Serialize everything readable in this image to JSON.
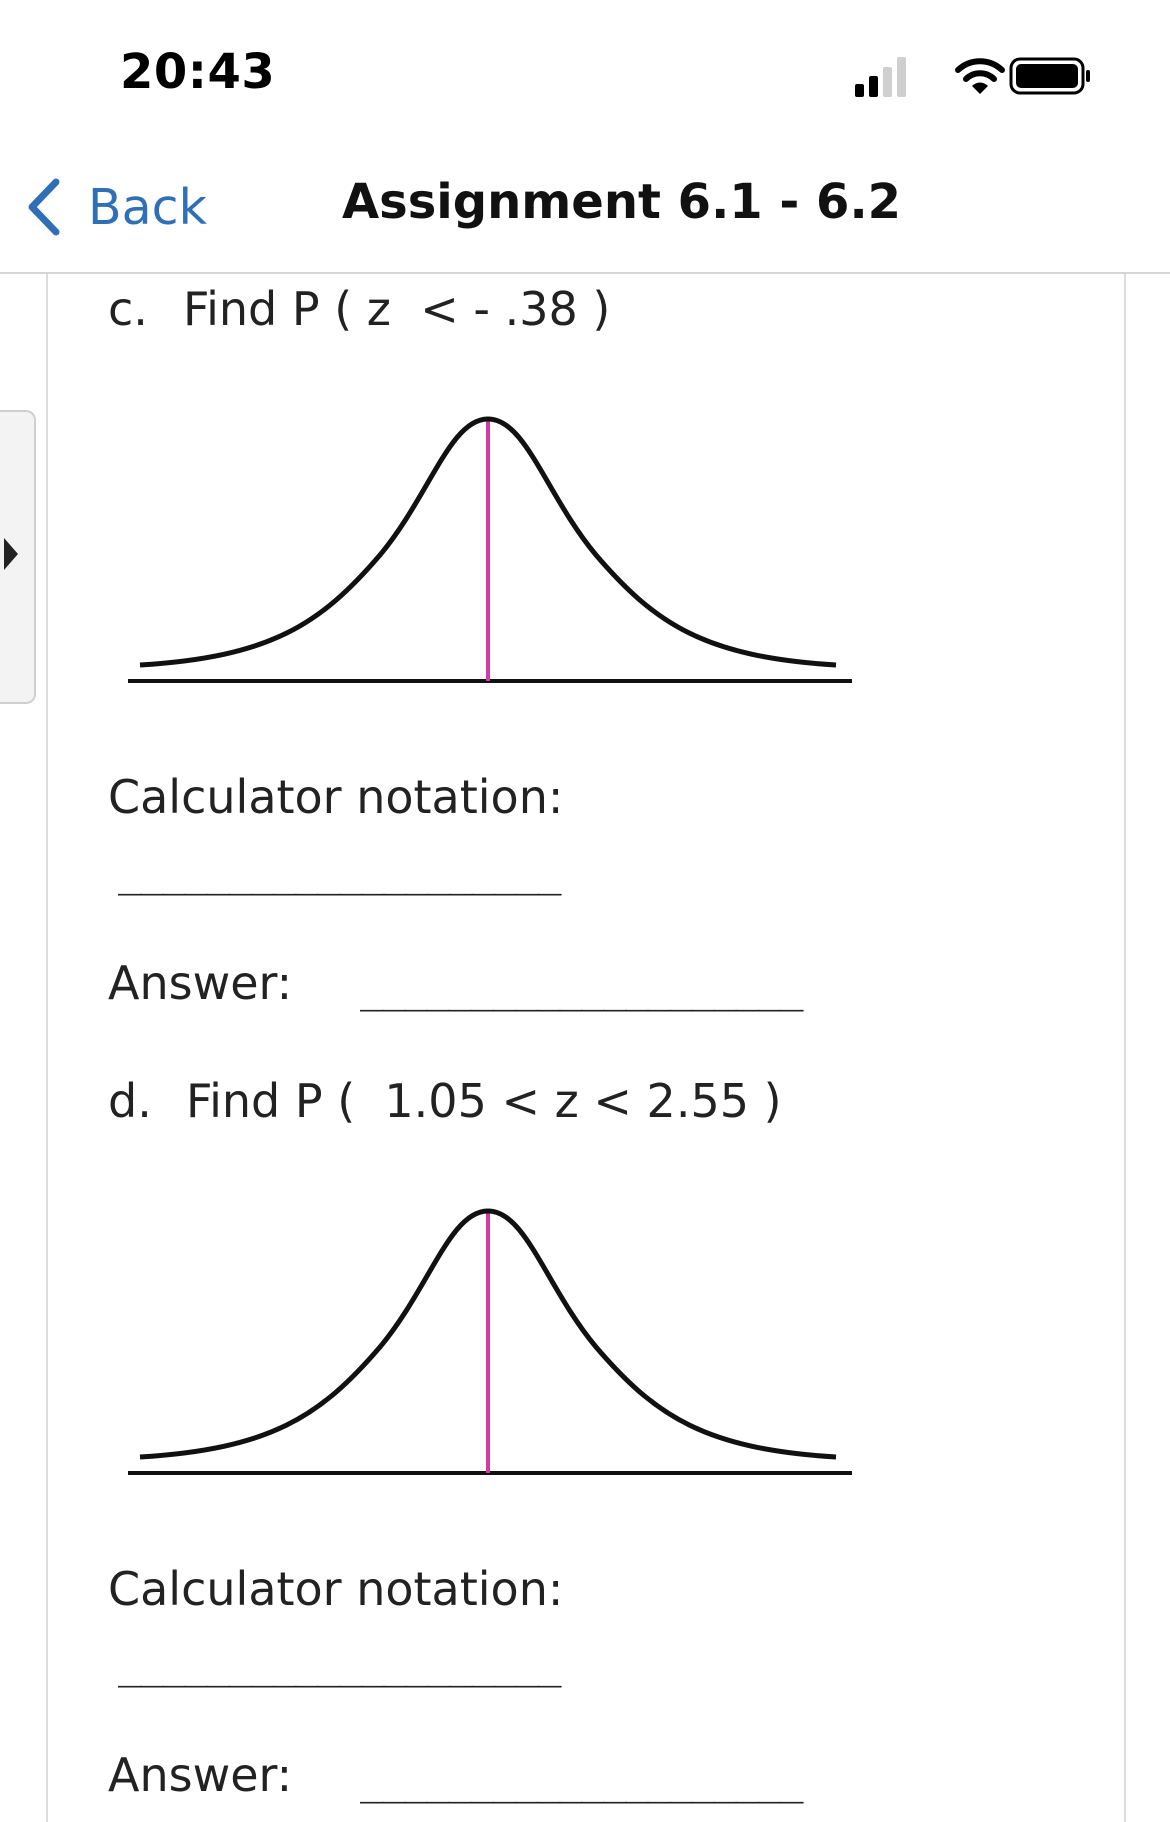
{
  "status_bar": {
    "time": "20:43",
    "signal_icon": "cellular-signal-icon",
    "wifi_icon": "wifi-icon",
    "battery_icon": "battery-icon"
  },
  "nav": {
    "back_label": "Back",
    "back_icon": "chevron-left-icon",
    "title": "Assignment 6.1 - 6.2",
    "accent_color": "#2f6fb7"
  },
  "side_panel": {
    "icon": "expand-arrow-icon"
  },
  "questions": [
    {
      "prefix": "c.",
      "text": "Find P ( z  < - .38 )",
      "curve_icon": "normal-curve-icon",
      "calculator_label": "Calculator notation:",
      "calculator_blank": "____________________",
      "answer_label": "Answer:",
      "answer_blank": "____________________"
    },
    {
      "prefix": "d.",
      "text": "Find P (  1.05 < z < 2.55 )",
      "curve_icon": "normal-curve-icon",
      "calculator_label": "Calculator notation:",
      "calculator_blank": "____________________",
      "answer_label": "Answer:",
      "answer_blank": "____________________"
    }
  ],
  "colors": {
    "curve_line": "#111111",
    "mean_line": "#d63aa6"
  }
}
